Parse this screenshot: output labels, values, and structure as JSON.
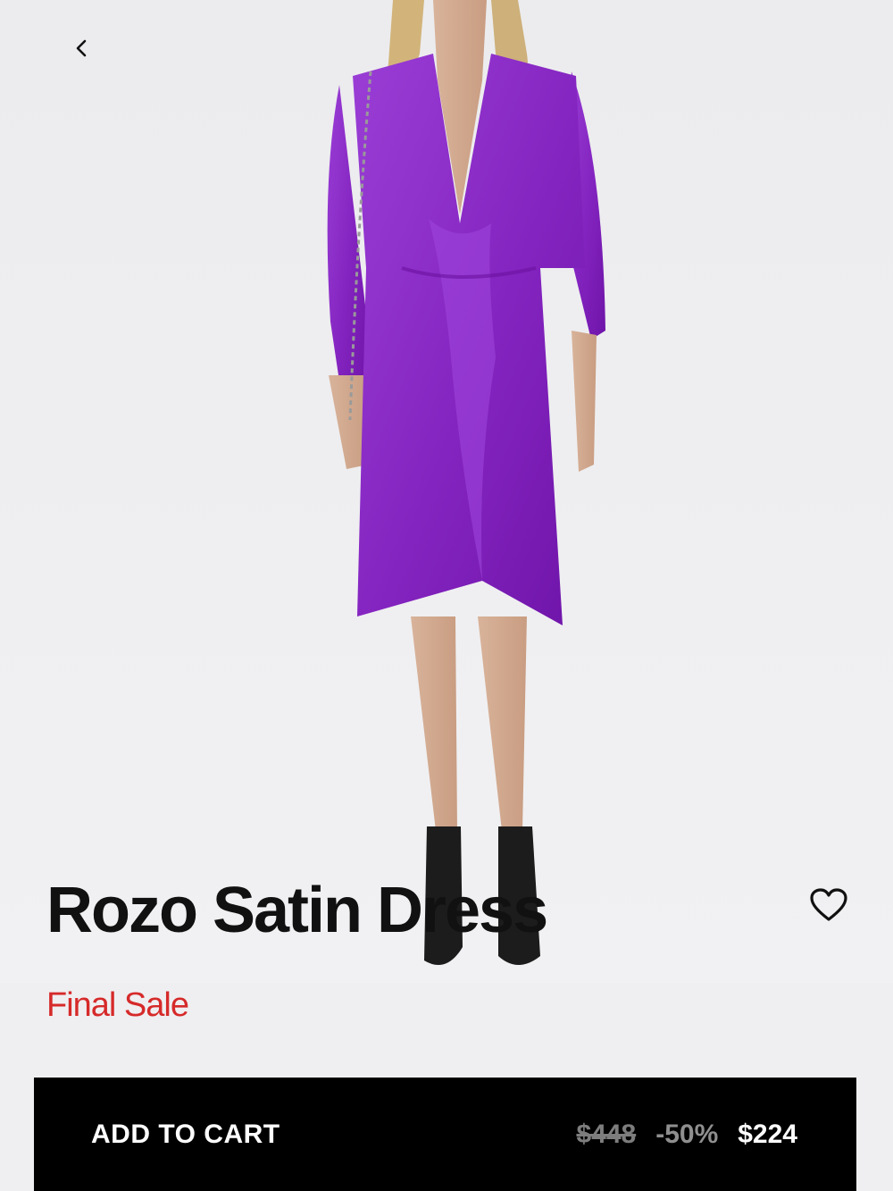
{
  "header": {
    "back_icon": "chevron-left-icon"
  },
  "product": {
    "title": "Rozo Satin Dress",
    "sale_note": "Final Sale",
    "favorite_icon": "heart-outline-icon",
    "image_description_colors": {
      "dress": "#8a2fc4",
      "background": "#efeff1"
    }
  },
  "cart_bar": {
    "label": "ADD TO CART",
    "original_price": "$448",
    "discount": "-50%",
    "sale_price": "$224"
  },
  "colors": {
    "accent_sale": "#d62a2a",
    "cart_background": "#000000",
    "title_text": "#111111"
  }
}
